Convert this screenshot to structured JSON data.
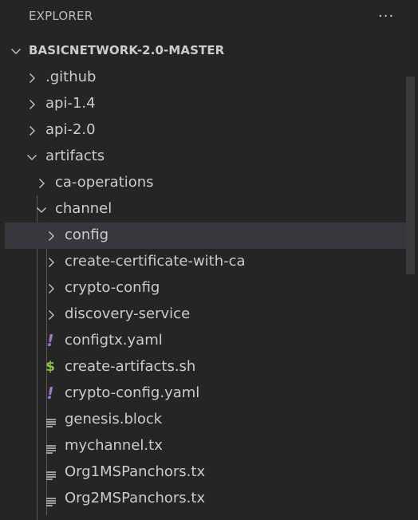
{
  "explorer": {
    "title": "EXPLORER",
    "more_icon": "ellipsis-icon",
    "more_label": "···"
  },
  "section": {
    "title": "BASICNETWORK-2.0-MASTER",
    "expanded": true
  },
  "tree": {
    "github": ".github",
    "api14": "api-1.4",
    "api20": "api-2.0",
    "artifacts": "artifacts",
    "ca_operations": "ca-operations",
    "channel": "channel",
    "config": "config",
    "create_cert": "create-certificate-with-ca",
    "crypto_config": "crypto-config",
    "discovery": "discovery-service",
    "configtx": "configtx.yaml",
    "create_artifacts": "create-artifacts.sh",
    "crypto_config_yaml": "crypto-config.yaml",
    "genesis": "genesis.block",
    "mychannel": "mychannel.tx",
    "org1": "Org1MSPanchors.tx",
    "org2": "Org2MSPanchors.tx"
  },
  "icons": {
    "yaml_glyph": "!",
    "sh_glyph": "$"
  },
  "colors": {
    "background": "#252526",
    "selected_row": "#37373d",
    "yaml_icon": "#a074c4",
    "shell_icon": "#8dc149",
    "text": "#cccccc"
  }
}
